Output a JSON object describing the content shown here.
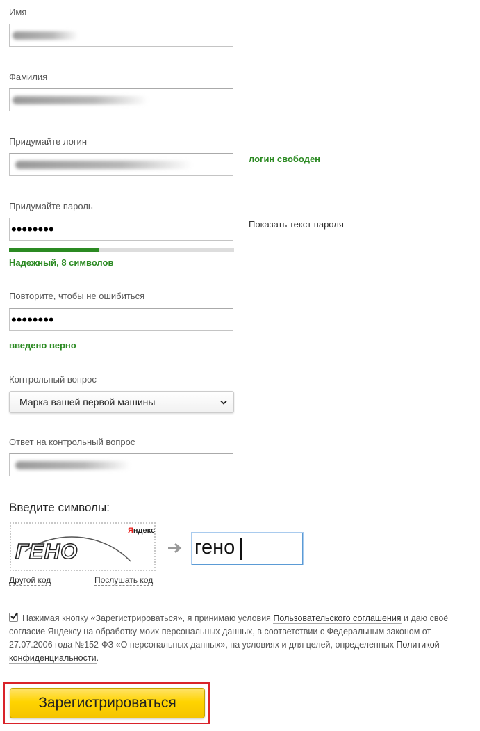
{
  "form": {
    "first_name": {
      "label": "Имя"
    },
    "last_name": {
      "label": "Фамилия"
    },
    "login": {
      "label": "Придумайте логин",
      "status": "логин свободен"
    },
    "password": {
      "label": "Придумайте пароль",
      "value": "••••••••",
      "show_text_link": "Показать текст пароля",
      "strength_text": "Надежный, 8 символов",
      "strength_fraction": 0.4,
      "strength_color": "#2b8a22"
    },
    "password_repeat": {
      "label": "Повторите, чтобы не ошибиться",
      "value": "••••••••",
      "status": "введено верно"
    },
    "security_question": {
      "label": "Контрольный вопрос",
      "selected": "Марка вашей первой машины"
    },
    "security_answer": {
      "label": "Ответ на контрольный вопрос"
    }
  },
  "captcha": {
    "heading": "Введите символы:",
    "image_text": "ГЕНО",
    "brand": "Яндекс",
    "input_value": "гено",
    "other_code_link": "Другой код",
    "listen_code_link": "Послушать код"
  },
  "terms": {
    "checked": true,
    "part1": "Нажимая кнопку «Зарегистрироваться», я принимаю условия ",
    "link_agreement": "Пользовательского соглашения",
    "part2": " и даю своё согласие Яндексу на обработку моих персональных данных, в соответствии с Федеральным законом от 27.07.2006 года №152-ФЗ «О персональных данных», на условиях и для целей, определенных ",
    "link_policy": "Политикой конфиденциальности",
    "part3": "."
  },
  "submit_label": "Зарегистрироваться",
  "colors": {
    "accent_yellow": "#ffd400",
    "success_green": "#2b8a22",
    "highlight_red": "#d9232a"
  }
}
